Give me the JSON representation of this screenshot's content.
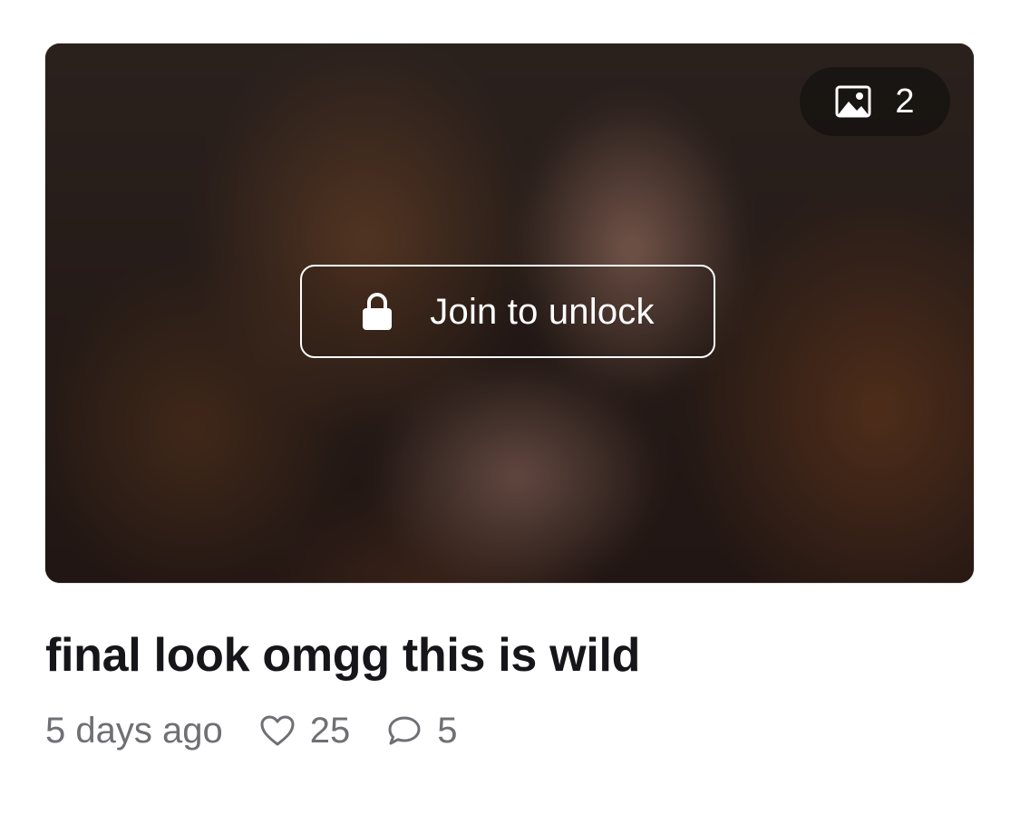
{
  "post": {
    "title": "final look omgg this is wild",
    "time_ago": "5 days ago",
    "likes": "25",
    "comments": "5"
  },
  "media": {
    "image_count": "2",
    "unlock_label": "Join to unlock",
    "icons": {
      "count": "image-icon",
      "lock": "lock-icon"
    }
  },
  "icons": {
    "likes": "heart-icon",
    "comments": "comment-bubble-icon"
  },
  "colors": {
    "text_primary": "#16161a",
    "text_secondary": "#6f6f74",
    "overlay_text": "#ffffff",
    "badge_bg": "#14100e"
  }
}
